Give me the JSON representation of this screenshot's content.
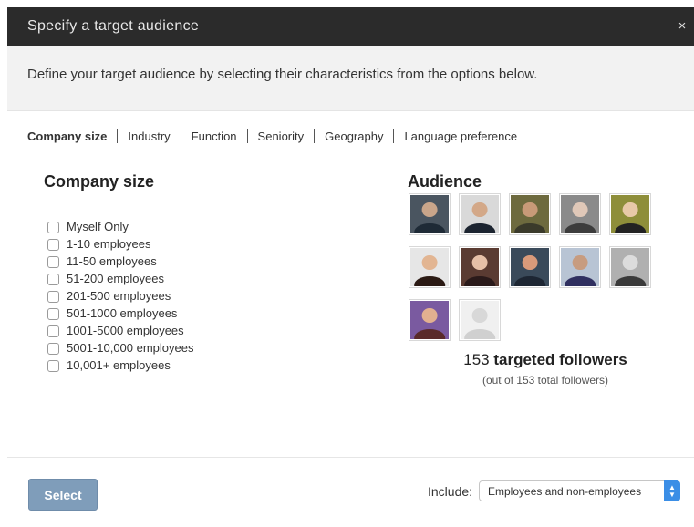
{
  "dialog": {
    "title": "Specify a target audience",
    "close_label": "×",
    "description": "Define your target audience by selecting their characteristics from the options below."
  },
  "tabs": [
    {
      "label": "Company size",
      "active": true
    },
    {
      "label": "Industry"
    },
    {
      "label": "Function"
    },
    {
      "label": "Seniority"
    },
    {
      "label": "Geography"
    },
    {
      "label": "Language preference"
    }
  ],
  "company_size": {
    "title": "Company size",
    "options": [
      "Myself Only",
      "1-10 employees",
      "11-50 employees",
      "51-200 employees",
      "201-500 employees",
      "501-1000 employees",
      "1001-5000 employees",
      "5001-10,000 employees",
      "10,001+ employees"
    ]
  },
  "audience": {
    "title": "Audience",
    "count": "153",
    "count_label": "targeted followers",
    "subtitle": "(out of 153 total followers)",
    "avatars": [
      {
        "bg": "#4a5560",
        "skin": "#c9a58a",
        "cloth": "#1e2a36"
      },
      {
        "bg": "#d9d9d9",
        "skin": "#d3a888",
        "cloth": "#1c2430"
      },
      {
        "bg": "#6d6a3e",
        "skin": "#c89a78",
        "cloth": "#3a3a2a"
      },
      {
        "bg": "#8a8a8a",
        "skin": "#e0c8b8",
        "cloth": "#3c3c3c"
      },
      {
        "bg": "#8e8e3a",
        "skin": "#e8c9a8",
        "cloth": "#222222"
      },
      {
        "bg": "#e6e6e6",
        "skin": "#e2b592",
        "cloth": "#2b1a14"
      },
      {
        "bg": "#5a3b32",
        "skin": "#e6c0a8",
        "cloth": "#2a1a1a"
      },
      {
        "bg": "#3a4a5a",
        "skin": "#d99a7a",
        "cloth": "#1d2633"
      },
      {
        "bg": "#b8c4d4",
        "skin": "#c79c80",
        "cloth": "#303060"
      },
      {
        "bg": "#b0b0b0",
        "skin": "#dcdcdc",
        "cloth": "#3a3a3a"
      },
      {
        "bg": "#7a5aa0",
        "skin": "#e2b090",
        "cloth": "#5a2a2a"
      },
      {
        "bg": "#f0f0f0",
        "skin": "#d8d8d8",
        "cloth": "#d0d0d0",
        "placeholder": true
      }
    ]
  },
  "footer": {
    "select_label": "Select",
    "include_label": "Include:",
    "include_value": "Employees and non-employees"
  },
  "colors": {
    "titlebar": "#2b2b2b",
    "select_button": "#7f9dba",
    "dropdown_arrow": "#3b8ee6"
  }
}
